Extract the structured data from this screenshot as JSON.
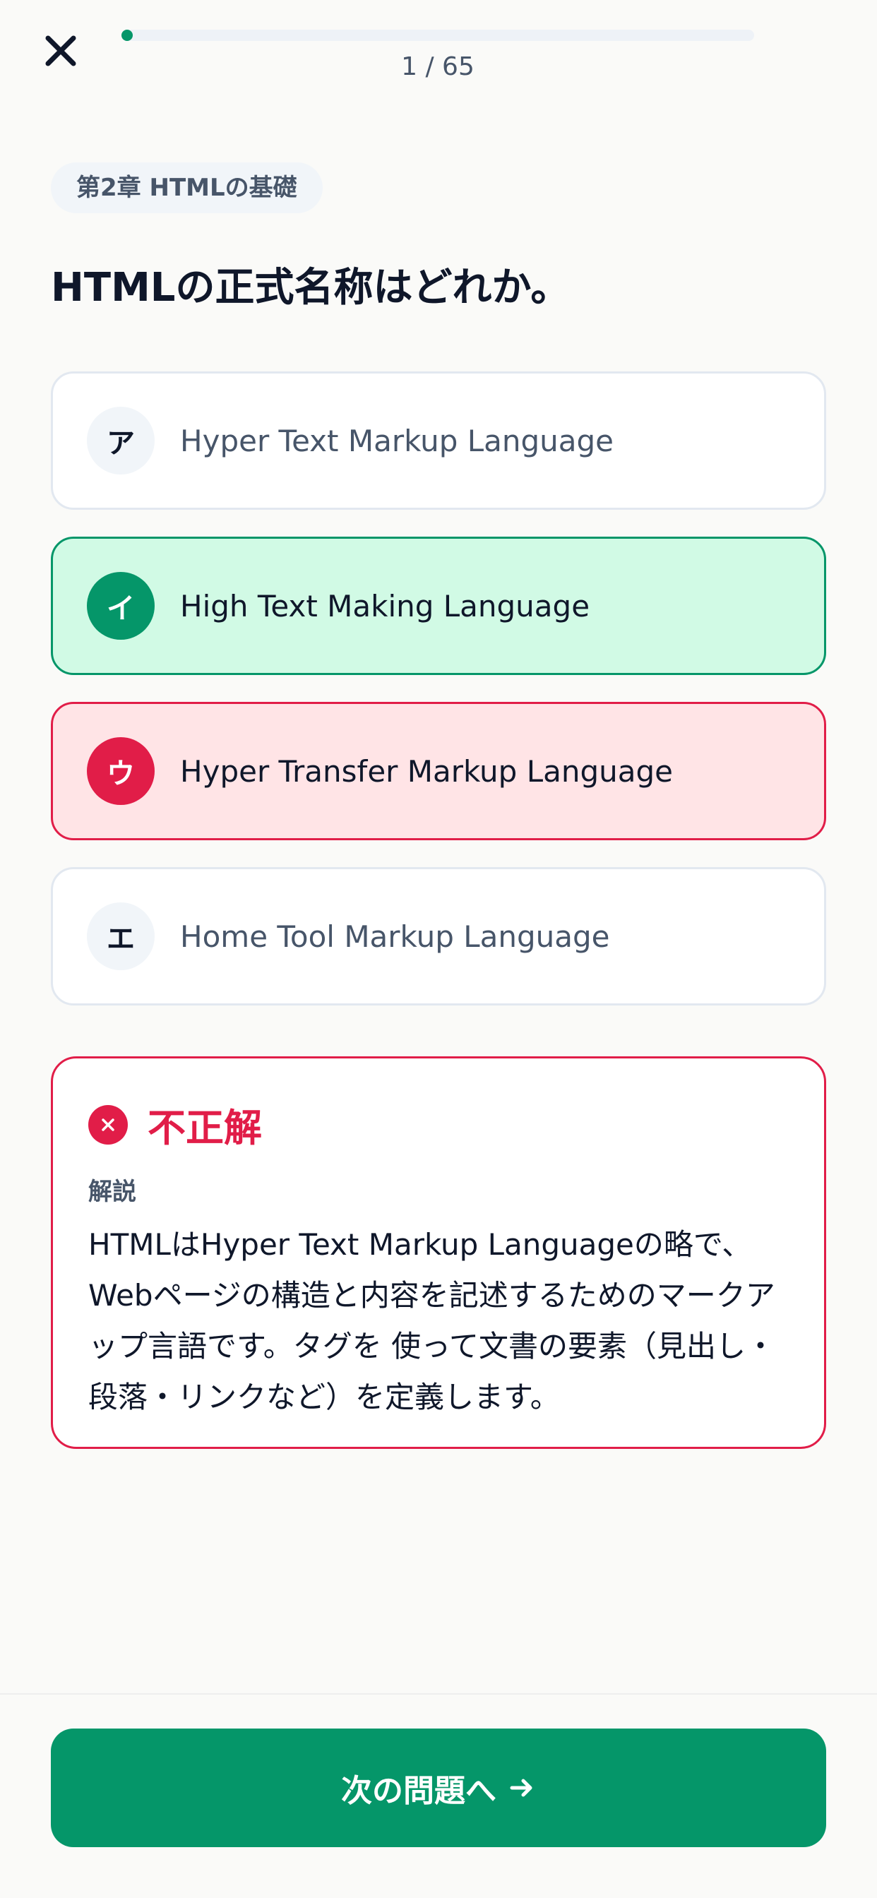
{
  "header": {
    "close_icon": "close-icon",
    "progress_text": "1 / 65",
    "progress_fraction": 0.0154
  },
  "chapter": "第2章 HTMLの基礎",
  "question": "HTMLの正式名称はどれか。",
  "options": [
    {
      "key": "ア",
      "text": "Hyper Text Markup Language",
      "state": "default"
    },
    {
      "key": "イ",
      "text": "High Text Making Language",
      "state": "correct"
    },
    {
      "key": "ウ",
      "text": "Hyper Transfer Markup Language",
      "state": "wrong"
    },
    {
      "key": "エ",
      "text": "Home Tool Markup Language",
      "state": "default"
    }
  ],
  "result": {
    "icon": "x-circle-icon",
    "title": "不正解",
    "explanation_label": "解説",
    "explanation": "HTMLはHyper Text Markup Languageの略で、Webページの構造と内容を記述するためのマークアップ言語です。タグを 使って文書の要素（見出し・段落・リンクなど）を定義します。"
  },
  "footer": {
    "next_label": "次の問題へ",
    "arrow_icon": "arrow-right-icon"
  },
  "colors": {
    "accent": "#059669",
    "error": "#E11D48",
    "correct_bg": "#D1FAE5",
    "wrong_bg": "#FFE4E6"
  }
}
